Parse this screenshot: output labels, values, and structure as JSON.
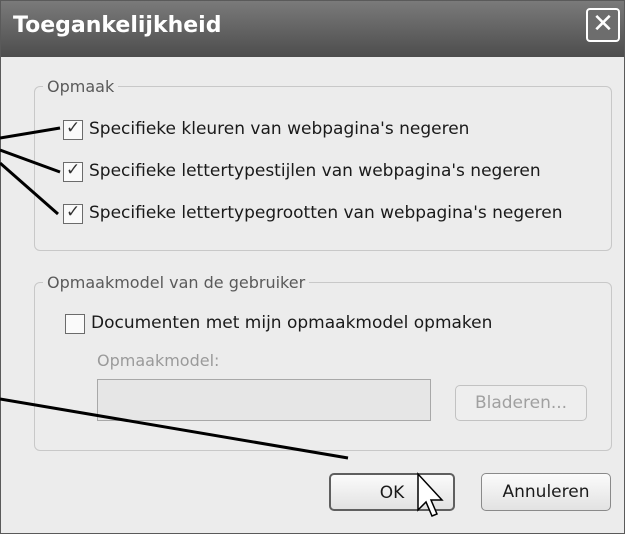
{
  "dialog": {
    "title": "Toegankelijkheid",
    "close_glyph": "✕"
  },
  "formatting_group": {
    "legend": "Opmaak",
    "options": [
      {
        "label": "Specifieke kleuren van webpagina's negeren",
        "checked": true
      },
      {
        "label": "Specifieke lettertypestijlen van webpagina's negeren",
        "checked": true
      },
      {
        "label": "Specifieke lettertypegrootten van webpagina's negeren",
        "checked": true
      }
    ]
  },
  "user_style_group": {
    "legend": "Opmaakmodel van de gebruiker",
    "format_option": {
      "label": "Documenten met mijn opmaakmodel opmaken",
      "checked": false
    },
    "style_sheet_label": "Opmaakmodel:",
    "style_sheet_value": "",
    "browse_label": "Bladeren..."
  },
  "buttons": {
    "ok_label": "OK",
    "cancel_label": "Annuleren"
  },
  "icons": {
    "checkmark": "✓",
    "cursor": "mouse-pointer-icon"
  },
  "colors": {
    "titlebar": "#5e5e5e",
    "dialog_background": "#ececec",
    "annotation_line": "#000000"
  }
}
